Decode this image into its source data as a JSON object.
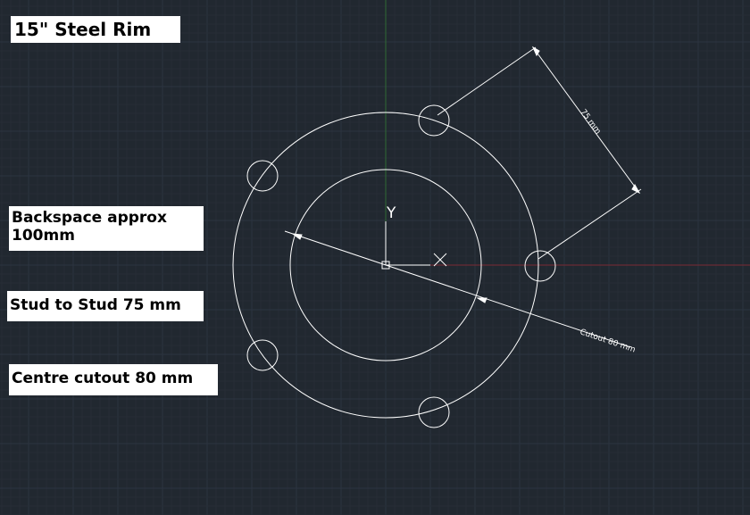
{
  "labels": {
    "title": "15\" Steel Rim",
    "backspace_line1": "Backspace approx",
    "backspace_line2": "100mm",
    "stud_to_stud": "Stud to Stud 75 mm",
    "centre_cutout": "Centre cutout 80 mm"
  },
  "dimensions": {
    "stud_dim_text": "75 mm",
    "cutout_dim_text": "Cutout 80 mm"
  },
  "ucs": {
    "y_label": "Y",
    "x_label": "X"
  },
  "colors": {
    "background": "#212830",
    "grid_minor": "#262d36",
    "grid_major": "#2c3440",
    "geometry": "#ffffff",
    "axis_x": "#7a2a35",
    "axis_y": "#2f6a35"
  }
}
